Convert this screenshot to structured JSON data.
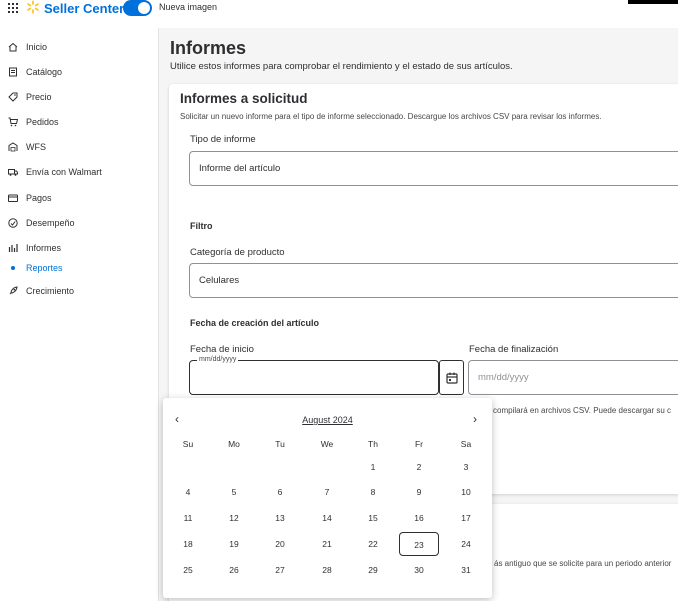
{
  "topbar": {
    "brand": "Seller Center",
    "toggle_label": "Nueva imagen",
    "accent": "#0071dc"
  },
  "sidebar": {
    "items": [
      {
        "label": "Inicio",
        "icon": "home-icon"
      },
      {
        "label": "Catálogo",
        "icon": "catalog-icon"
      },
      {
        "label": "Precio",
        "icon": "tag-icon"
      },
      {
        "label": "Pedidos",
        "icon": "cart-icon"
      },
      {
        "label": "WFS",
        "icon": "warehouse-icon"
      },
      {
        "label": "Envía con Walmart",
        "icon": "truck-icon"
      },
      {
        "label": "Pagos",
        "icon": "card-icon"
      },
      {
        "label": "Desempeño",
        "icon": "gauge-icon"
      },
      {
        "label": "Informes",
        "icon": "bar-chart-icon"
      }
    ],
    "subitem": "Reportes",
    "after": [
      {
        "label": "Crecimiento",
        "icon": "rocket-icon"
      }
    ]
  },
  "main": {
    "title": "Informes",
    "subtitle": "Utilice estos informes para comprobar el rendimiento y el estado de sus artículos.",
    "card": {
      "title": "Informes a solicitud",
      "subtitle": "Solicitar un nuevo informe para el tipo de informe seleccionado. Descargue los archivos CSV para revisar los informes.",
      "report_type_label": "Tipo de informe",
      "report_type_value": "Informe del artículo",
      "filter_heading": "Filtro",
      "category_label": "Categoría de producto",
      "category_value": "Celulares",
      "date_heading": "Fecha de creación del artículo",
      "start_label": "Fecha de inicio",
      "start_float": "mm/dd/yyyy",
      "end_label": "Fecha de finalización",
      "end_placeholder": "mm/dd/yyyy",
      "note_partial": "compilará en archivos CSV. Puede descargar su c"
    },
    "card2_note": "ás antiguo que se solicite para un periodo anterior"
  },
  "datepicker": {
    "month": "August 2024",
    "prev": "‹",
    "next": "›",
    "weekdays": [
      "Su",
      "Mo",
      "Tu",
      "We",
      "Th",
      "Fr",
      "Sa"
    ],
    "weeks": [
      [
        "",
        "",
        "",
        "",
        "1",
        "2",
        "3"
      ],
      [
        "4",
        "5",
        "6",
        "7",
        "8",
        "9",
        "10"
      ],
      [
        "11",
        "12",
        "13",
        "14",
        "15",
        "16",
        "17"
      ],
      [
        "18",
        "19",
        "20",
        "21",
        "22",
        "23",
        "24"
      ],
      [
        "25",
        "26",
        "27",
        "28",
        "29",
        "30",
        "31"
      ]
    ],
    "today": "23"
  }
}
